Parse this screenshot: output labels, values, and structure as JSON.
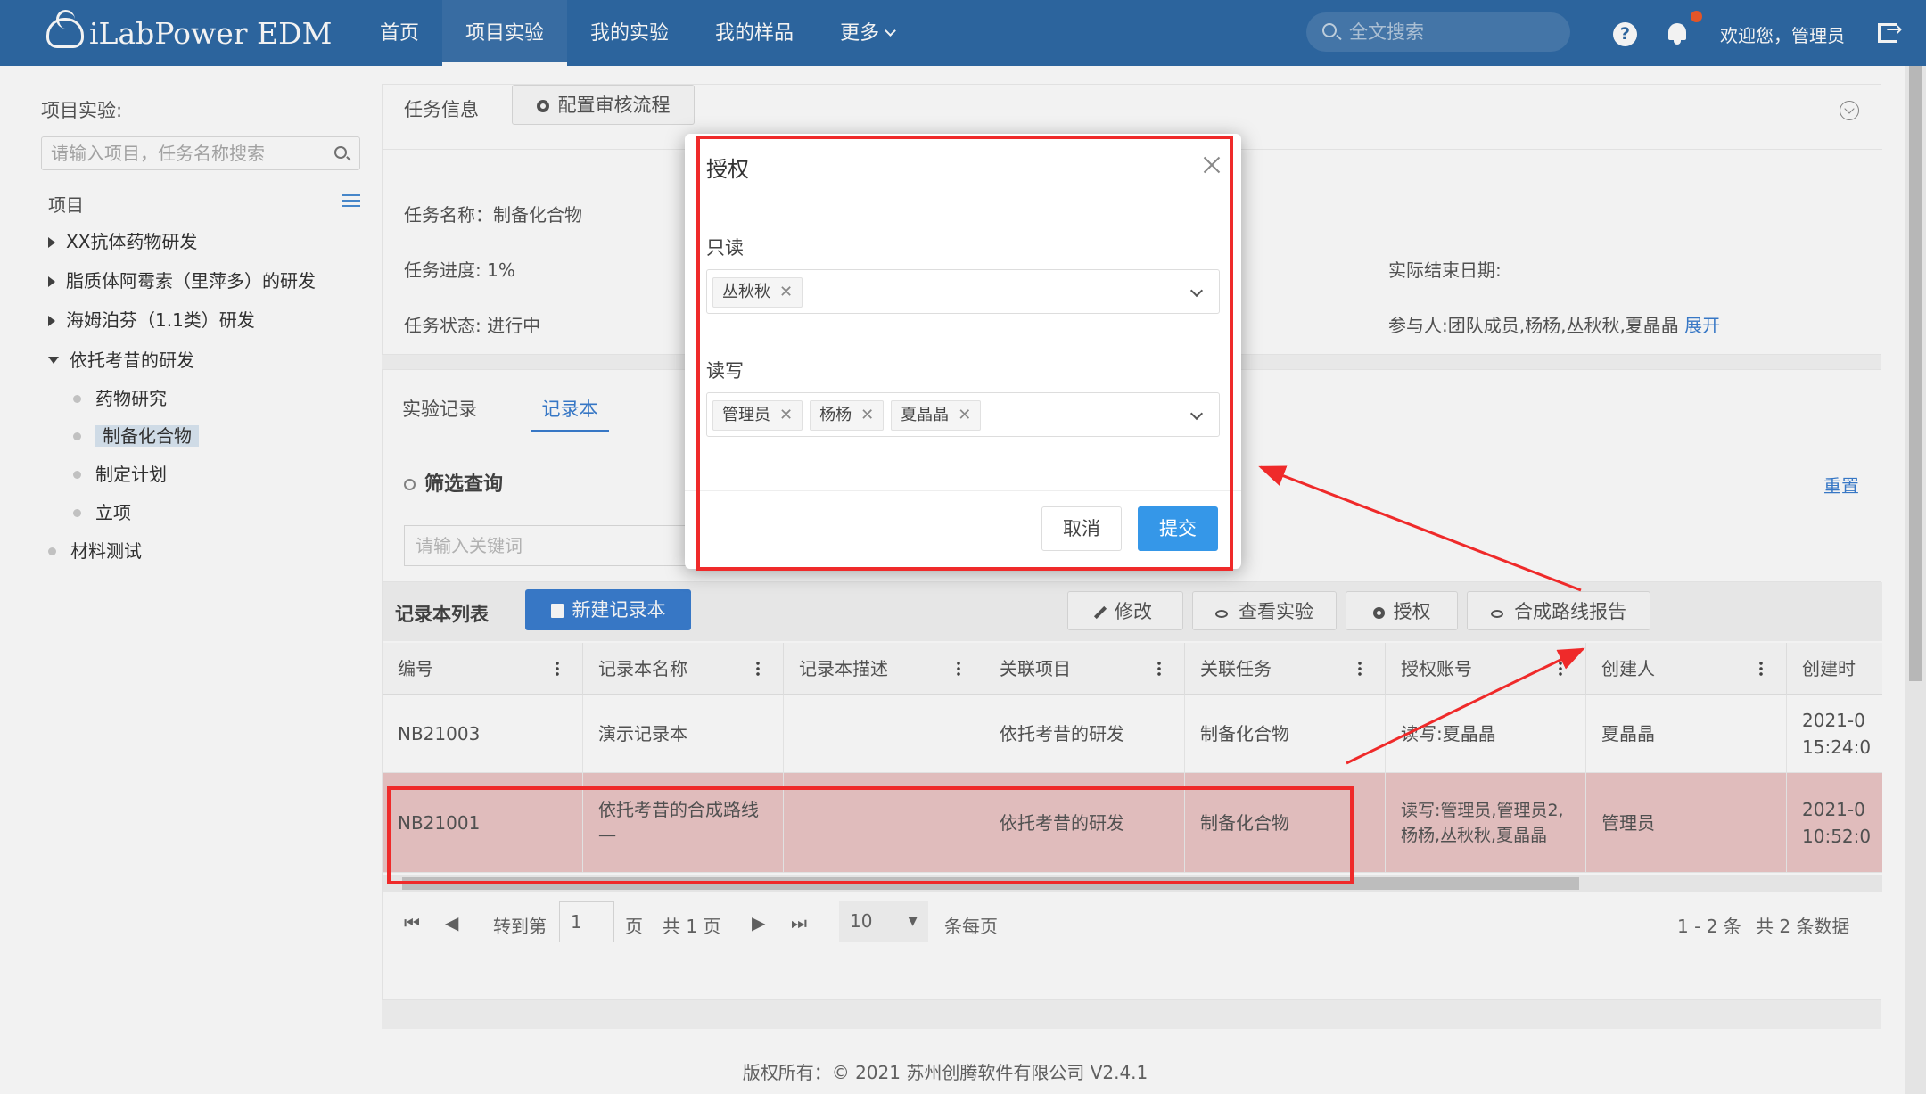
{
  "app": {
    "logo": "iLabPower EDM"
  },
  "nav": {
    "items": [
      "首页",
      "项目实验",
      "我的实验",
      "我的样品",
      "更多"
    ],
    "search_placeholder": "全文搜索",
    "help_icon": "question-circle-icon",
    "welcome": "欢迎您，管理员"
  },
  "sidebar": {
    "title": "项目实验:",
    "search_placeholder": "请输入项目，任务名称搜索",
    "tree_head": "项目",
    "projects": [
      "XX抗体药物研发",
      "脂质体阿霉素（里萍多）的研发",
      "海姆泊芬（1.1类）研发",
      "依托考昔的研发"
    ],
    "children": [
      "药物研究",
      "制备化合物",
      "制定计划",
      "立项"
    ],
    "other": "材料测试"
  },
  "task": {
    "title": "任务信息",
    "config_button": "配置审核流程",
    "name": "任务名称：制备化合物",
    "progress": "任务进度: 1%",
    "status": "任务状态: 进行中",
    "end_date": "实际结束日期:",
    "participants": "参与人:团队成员,杨杨,丛秋秋,夏晶晶",
    "expand": "展开"
  },
  "tabs": [
    "实验记录",
    "记录本"
  ],
  "filter": {
    "title": "筛选查询",
    "reset": "重置",
    "keyword_placeholder": "请输入关键词"
  },
  "list": {
    "title": "记录本列表",
    "new_button": "新建记录本",
    "tools": [
      "修改",
      "查看实验",
      "授权",
      "合成路线报告"
    ],
    "columns": [
      "编号",
      "记录本名称",
      "记录本描述",
      "关联项目",
      "关联任务",
      "授权账号",
      "创建人",
      "创建时"
    ],
    "rows": [
      {
        "id": "NB21003",
        "name": "演示记录本",
        "desc": "",
        "project": "依托考昔的研发",
        "task": "制备化合物",
        "auth": "读写:夏晶晶",
        "creator": "夏晶晶",
        "created_1": "2021-0",
        "created_2": "15:24:0"
      },
      {
        "id": "NB21001",
        "name": "依托考昔的合成路线一",
        "desc": "",
        "project": "依托考昔的研发",
        "task": "制备化合物",
        "auth": "读写:管理员,管理员2,杨杨,丛秋秋,夏晶晶",
        "creator": "管理员",
        "created_1": "2021-0",
        "created_2": "10:52:0"
      }
    ]
  },
  "pager": {
    "goto": "转到第",
    "page_value": "1",
    "page_unit": "页",
    "total_pages": "共 1 页",
    "page_size": "10",
    "per_page": "条每页",
    "range": "1 - 2 条",
    "total": "共 2 条数据"
  },
  "footer": "版权所有：© 2021 苏州创腾软件有限公司   V2.4.1",
  "dialog": {
    "title": "授权",
    "readonly_label": "只读",
    "readonly_users": [
      "丛秋秋"
    ],
    "readwrite_label": "读写",
    "readwrite_users": [
      "管理员",
      "杨杨",
      "夏晶晶"
    ],
    "cancel": "取消",
    "submit": "提交"
  },
  "colors": {
    "header": "#2f6aa6",
    "accent": "#3a7ed0",
    "submit": "#3597e8",
    "annotation": "#ef2a2a",
    "selected_row": "#ecc7c7"
  }
}
